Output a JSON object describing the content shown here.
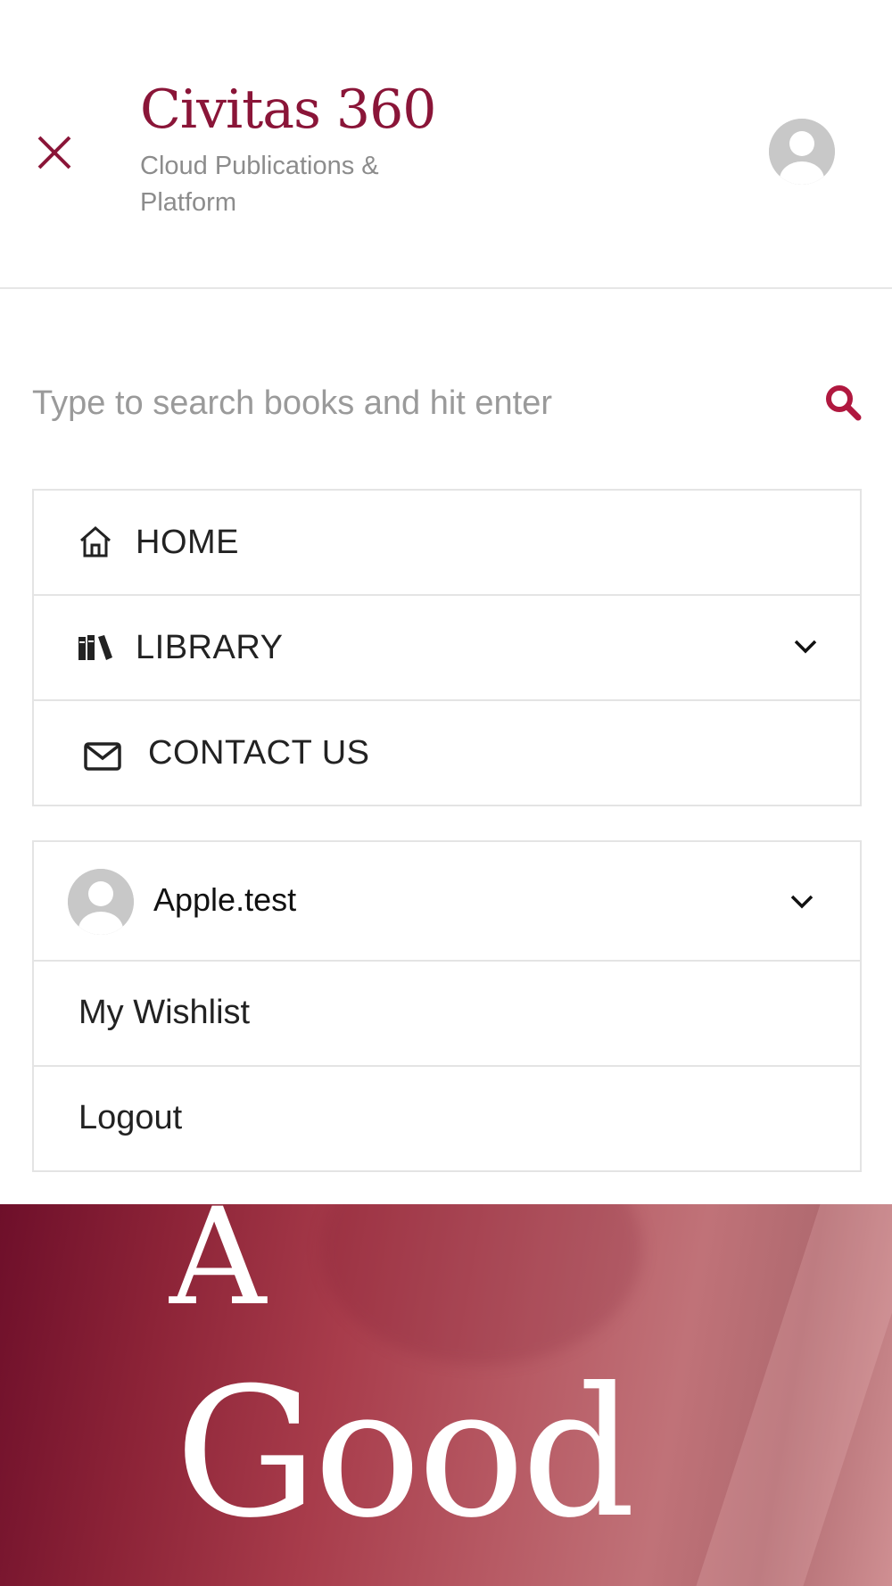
{
  "brand": {
    "title": "Civitas 360",
    "subtitle": "Cloud Publications & Platform",
    "accent_color": "#8a1538"
  },
  "search": {
    "placeholder": "Type to search books and hit enter"
  },
  "menu": {
    "items": [
      {
        "label": "HOME",
        "icon": "home-icon"
      },
      {
        "label": "LIBRARY",
        "icon": "books-icon"
      },
      {
        "label": "CONTACT US",
        "icon": "envelope-icon"
      }
    ]
  },
  "user": {
    "name": "Apple.test",
    "items": [
      {
        "label": "My Wishlist"
      },
      {
        "label": "Logout"
      }
    ]
  },
  "hero": {
    "line1": "A",
    "line2": "Good"
  }
}
